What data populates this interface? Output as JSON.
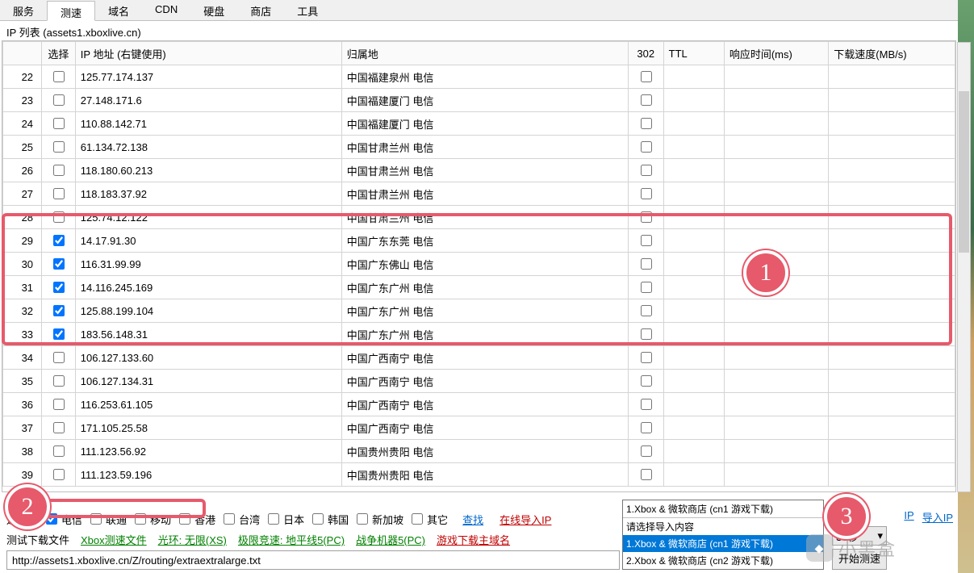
{
  "tabs": [
    "服务",
    "测速",
    "域名",
    "CDN",
    "硬盘",
    "商店",
    "工具"
  ],
  "activeTab": 1,
  "subtitle": "IP 列表 (assets1.xboxlive.cn)",
  "columns": {
    "num": "",
    "sel": "选择",
    "ip": "IP 地址 (右键使用)",
    "loc": "归属地",
    "c302": "302",
    "ttl": "TTL",
    "rt": "响应时间(ms)",
    "spd": "下载速度(MB/s)"
  },
  "rows": [
    {
      "n": 22,
      "sel": false,
      "ip": "125.77.174.137",
      "loc": "中国福建泉州 电信"
    },
    {
      "n": 23,
      "sel": false,
      "ip": "27.148.171.6",
      "loc": "中国福建厦门 电信"
    },
    {
      "n": 24,
      "sel": false,
      "ip": "110.88.142.71",
      "loc": "中国福建厦门 电信"
    },
    {
      "n": 25,
      "sel": false,
      "ip": "61.134.72.138",
      "loc": "中国甘肃兰州 电信"
    },
    {
      "n": 26,
      "sel": false,
      "ip": "118.180.60.213",
      "loc": "中国甘肃兰州 电信"
    },
    {
      "n": 27,
      "sel": false,
      "ip": "118.183.37.92",
      "loc": "中国甘肃兰州 电信"
    },
    {
      "n": 28,
      "sel": false,
      "ip": "125.74.12.122",
      "loc": "中国甘肃兰州 电信"
    },
    {
      "n": 29,
      "sel": true,
      "ip": "14.17.91.30",
      "loc": "中国广东东莞 电信"
    },
    {
      "n": 30,
      "sel": true,
      "ip": "116.31.99.99",
      "loc": "中国广东佛山 电信"
    },
    {
      "n": 31,
      "sel": true,
      "ip": "14.116.245.169",
      "loc": "中国广东广州 电信"
    },
    {
      "n": 32,
      "sel": true,
      "ip": "125.88.199.104",
      "loc": "中国广东广州 电信"
    },
    {
      "n": 33,
      "sel": true,
      "ip": "183.56.148.31",
      "loc": "中国广东广州 电信"
    },
    {
      "n": 34,
      "sel": false,
      "ip": "106.127.133.60",
      "loc": "中国广西南宁 电信"
    },
    {
      "n": 35,
      "sel": false,
      "ip": "106.127.134.31",
      "loc": "中国广西南宁 电信"
    },
    {
      "n": 36,
      "sel": false,
      "ip": "116.253.61.105",
      "loc": "中国广西南宁 电信"
    },
    {
      "n": 37,
      "sel": false,
      "ip": "171.105.25.58",
      "loc": "中国广西南宁 电信"
    },
    {
      "n": 38,
      "sel": false,
      "ip": "111.123.56.92",
      "loc": "中国贵州贵阳 电信"
    },
    {
      "n": 39,
      "sel": false,
      "ip": "111.123.59.196",
      "loc": "中国贵州贵阳 电信"
    }
  ],
  "filter": {
    "label": "运营商",
    "items": [
      {
        "label": "电信",
        "checked": true
      },
      {
        "label": "联通",
        "checked": false
      },
      {
        "label": "移动",
        "checked": false
      },
      {
        "label": "香港",
        "checked": false
      },
      {
        "label": "台湾",
        "checked": false
      },
      {
        "label": "日本",
        "checked": false
      },
      {
        "label": "韩国",
        "checked": false
      },
      {
        "label": "新加坡",
        "checked": false
      },
      {
        "label": "其它",
        "checked": false
      }
    ],
    "find": "查找",
    "onlineImport": "在线导入IP"
  },
  "linksRow": {
    "label": "测试下载文件",
    "items": [
      {
        "text": "Xbox测速文件",
        "cls": "link-green"
      },
      {
        "text": "光环: 无限(XS)",
        "cls": "link-green"
      },
      {
        "text": "极限竞速: 地平线5(PC)",
        "cls": "link-green"
      },
      {
        "text": "战争机器5(PC)",
        "cls": "link-green"
      },
      {
        "text": "游戏下载主域名",
        "cls": "link-red"
      }
    ]
  },
  "rightLinks": {
    "exportIP": "导出IP",
    "importIP": "导入IP",
    "selIP": "IP"
  },
  "url": "http://assets1.xboxlive.cn/Z/routing/extraextralarge.txt",
  "dropdown": {
    "selected": "1.Xbox & 微软商店 (cn1 游戏下载)",
    "placeholder": "请选择导入内容",
    "options": [
      "1.Xbox & 微软商店 (cn1 游戏下载)",
      "2.Xbox & 微软商店 (cn2 游戏下载)"
    ],
    "hl": 0
  },
  "secSelect": "30秒",
  "startBtn": "开始测速",
  "annotations": {
    "one": "1",
    "two": "2",
    "three": "3"
  },
  "watermark": "小黑盒"
}
